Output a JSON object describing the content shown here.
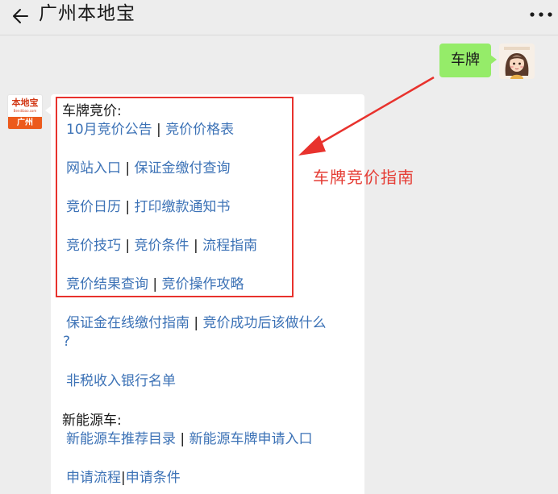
{
  "header": {
    "title": "广州本地宝",
    "back_icon": "arrow-left-icon",
    "more_icon": "more-dots-icon"
  },
  "outgoing": {
    "text": "车牌",
    "bubble_color": "#95ec69"
  },
  "incoming": {
    "logo_text": "本地宝",
    "logo_sub": "Bendibao.com",
    "logo_city": "广州",
    "sections": {
      "plate_bidding": {
        "heading": "车牌竞价:",
        "rows": [
          [
            "10月竞价公告",
            "竞价价格表"
          ],
          [
            "网站入口",
            "保证金缴付查询"
          ],
          [
            "竞价日历",
            "打印缴款通知书"
          ],
          [
            "竞价技巧",
            "竞价条件",
            "流程指南"
          ],
          [
            "竞价结果查询",
            "竞价操作攻略"
          ]
        ],
        "extra": {
          "link1": "保证金在线缴付指南",
          "link2": "竞价成功后该做什么",
          "link2_cont": "?",
          "link3": "非税收入银行名单"
        }
      },
      "new_energy": {
        "heading": "新能源车:",
        "rows": [
          [
            "新能源车推荐目录",
            "新能源车牌申请入口"
          ],
          [
            "申请流程",
            "申请条件"
          ]
        ]
      }
    },
    "separator": "|",
    "link_color": "#3c72b6"
  },
  "annotation": {
    "text": "车牌竞价指南",
    "color": "#e53c34"
  }
}
